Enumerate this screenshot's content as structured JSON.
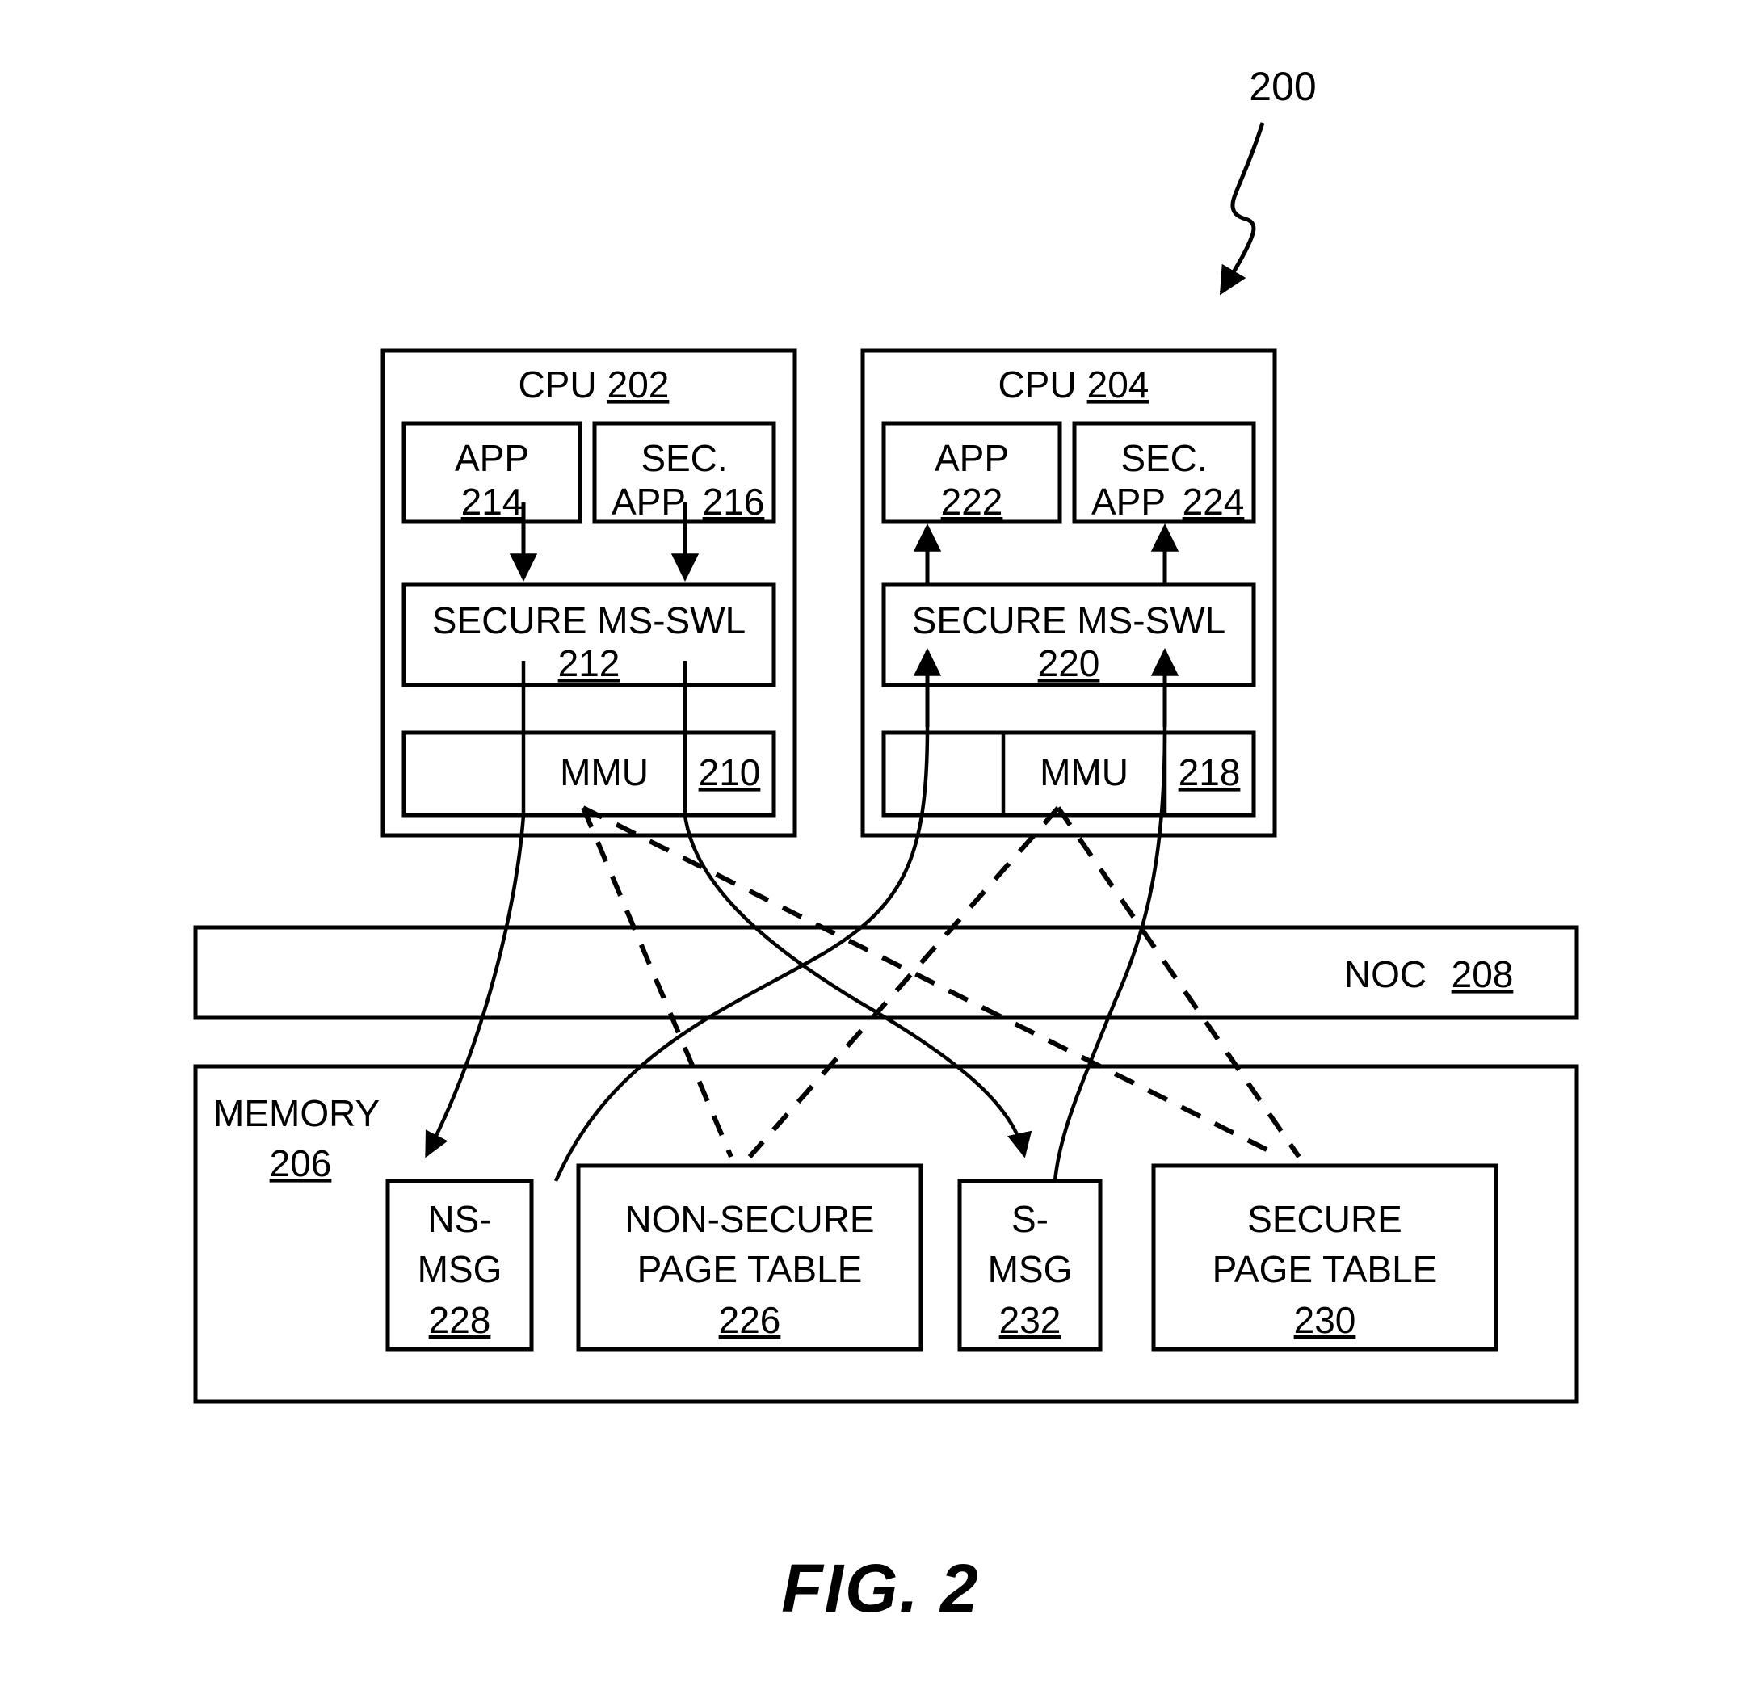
{
  "figure": {
    "caption": "FIG. 2",
    "system_ref": "200"
  },
  "cpus": [
    {
      "title": "CPU",
      "ref": "202",
      "app": {
        "label": "APP",
        "ref": "214"
      },
      "sec_app": {
        "label_line1": "SEC.",
        "label_line2": "APP",
        "ref": "216"
      },
      "swl": {
        "label": "SECURE MS-SWL",
        "ref": "212"
      },
      "mmu": {
        "label": "MMU",
        "ref": "210"
      }
    },
    {
      "title": "CPU",
      "ref": "204",
      "app": {
        "label": "APP",
        "ref": "222"
      },
      "sec_app": {
        "label_line1": "SEC.",
        "label_line2": "APP",
        "ref": "224"
      },
      "swl": {
        "label": "SECURE MS-SWL",
        "ref": "220"
      },
      "mmu": {
        "label": "MMU",
        "ref": "218"
      }
    }
  ],
  "noc": {
    "label": "NOC",
    "ref": "208"
  },
  "memory": {
    "label": "MEMORY",
    "ref": "206",
    "blocks": [
      {
        "line1": "NS-",
        "line2": "MSG",
        "ref": "228"
      },
      {
        "line1": "NON-SECURE",
        "line2": "PAGE TABLE",
        "ref": "226"
      },
      {
        "line1": "S-",
        "line2": "MSG",
        "ref": "232"
      },
      {
        "line1": "SECURE",
        "line2": "PAGE TABLE",
        "ref": "230"
      }
    ]
  },
  "colors": {
    "stroke": "#000000",
    "background": "#ffffff"
  }
}
